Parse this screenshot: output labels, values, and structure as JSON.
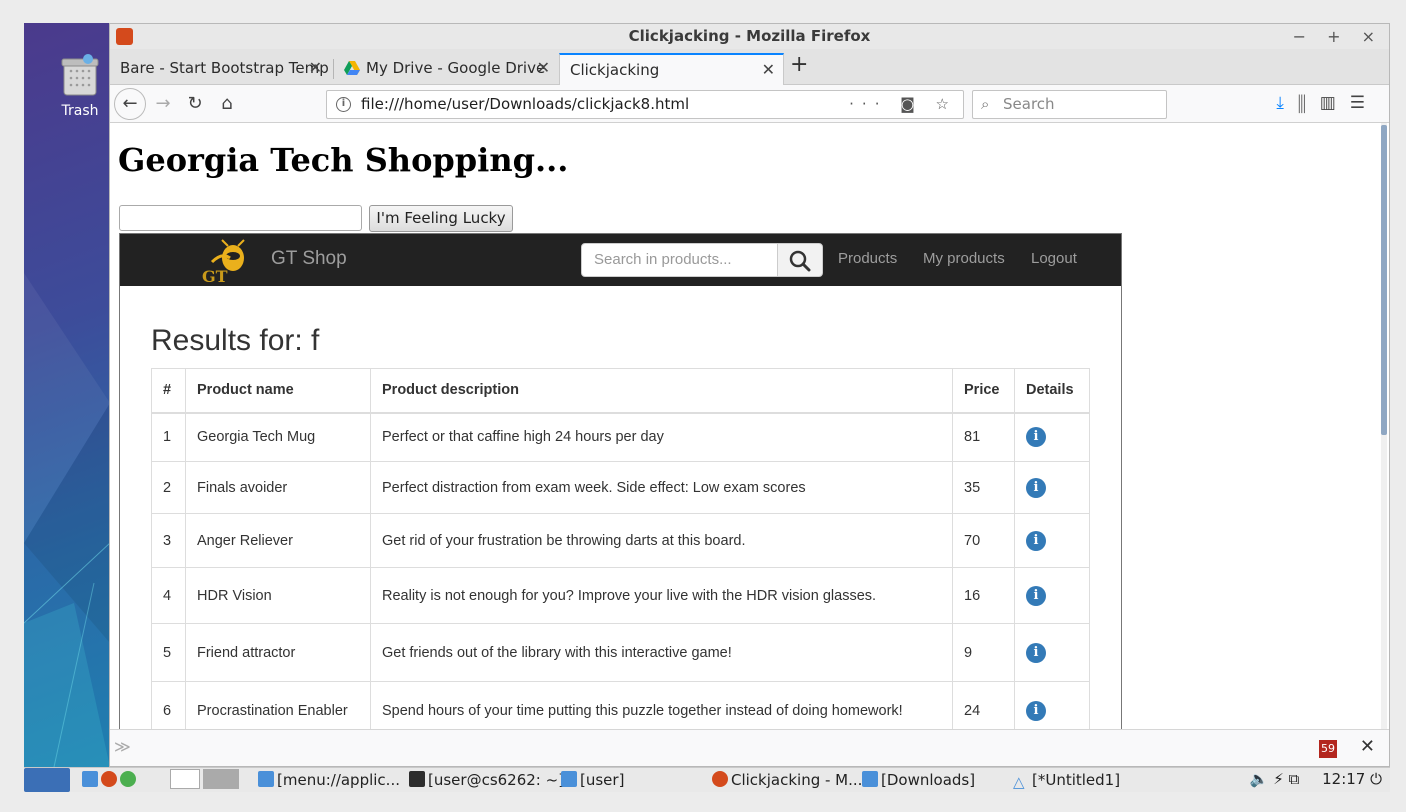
{
  "window": {
    "title": "Clickjacking - Mozilla Firefox",
    "controls": "− + ×"
  },
  "desktop": {
    "trash_label": "Trash"
  },
  "tabs": [
    {
      "label": "Bare - Start Bootstrap Temp",
      "active": false
    },
    {
      "label": "My Drive - Google Drive",
      "active": false
    },
    {
      "label": "Clickjacking",
      "active": true
    }
  ],
  "navbar": {
    "url": "file:///home/user/Downloads/clickjack8.html",
    "search_placeholder": "Search"
  },
  "page": {
    "title": "Georgia Tech Shopping...",
    "lucky_button": "I'm Feeling Lucky"
  },
  "shop": {
    "brand": "GT Shop",
    "search_placeholder": "Search in products...",
    "nav_links": [
      "Products",
      "My products",
      "Logout"
    ],
    "results_title": "Results for: f",
    "columns": [
      "#",
      "Product name",
      "Product description",
      "Price",
      "Details"
    ],
    "rows": [
      {
        "num": "1",
        "name": "Georgia Tech Mug",
        "desc": "Perfect or that caffine high 24 hours per day",
        "price": "81"
      },
      {
        "num": "2",
        "name": "Finals avoider",
        "desc": "Perfect distraction from exam week. Side effect: Low exam scores",
        "price": "35"
      },
      {
        "num": "3",
        "name": "Anger Reliever",
        "desc": "Get rid of your frustration be throwing darts at this board.",
        "price": "70"
      },
      {
        "num": "4",
        "name": "HDR Vision",
        "desc": "Reality is not enough for you? Improve your live with the HDR vision glasses.",
        "price": "16"
      },
      {
        "num": "5",
        "name": "Friend attractor",
        "desc": "Get friends out of the library with this interactive game!",
        "price": "9"
      },
      {
        "num": "6",
        "name": "Procrastination Enabler",
        "desc": "Spend hours of your time putting this puzzle together instead of doing homework!",
        "price": "24"
      }
    ],
    "accent_color": "#337ab7"
  },
  "findbar": {
    "badge": "59"
  },
  "taskbar": {
    "items": [
      "[menu://applic...",
      "[user@cs6262: ~]",
      "[user]",
      "Clickjacking - M...",
      "[Downloads]",
      "[*Untitled1]"
    ],
    "clock": "12:17"
  }
}
